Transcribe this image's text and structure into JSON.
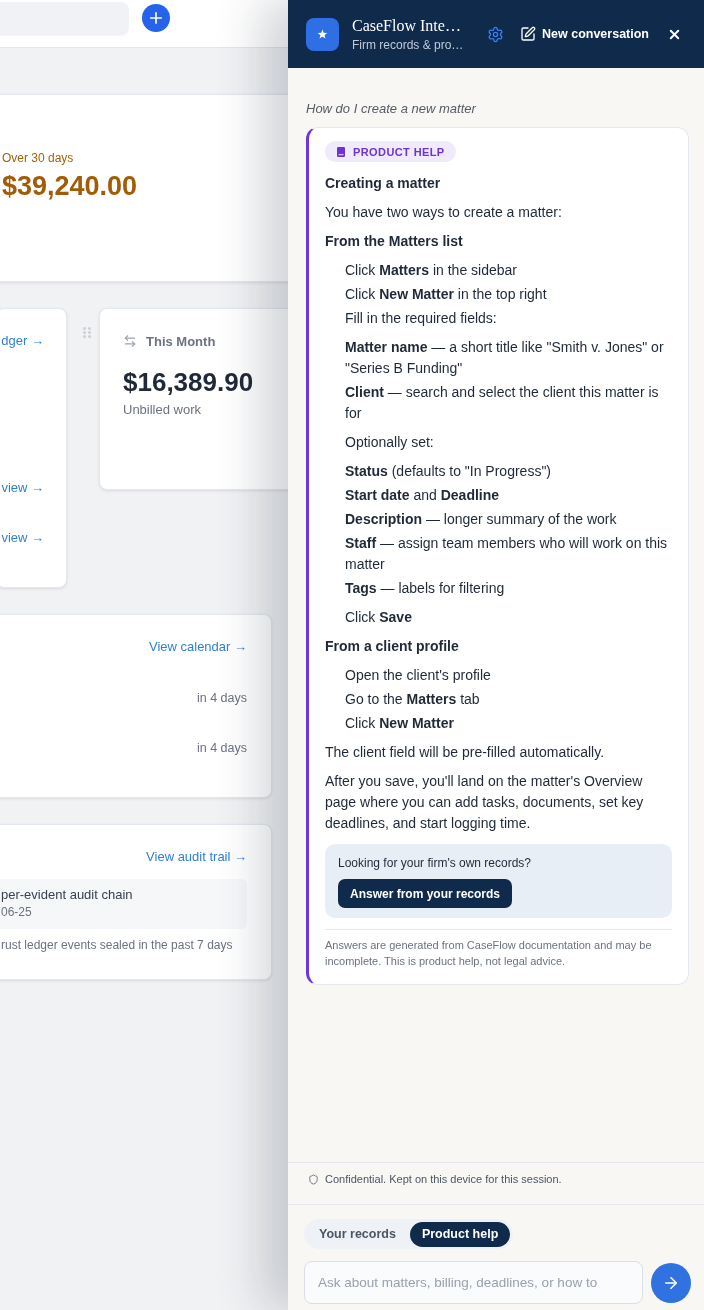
{
  "dashboard": {
    "aging_card": {
      "label": "Over 30 days",
      "amount": "$39,240.00"
    },
    "ledger_card": {
      "links": [
        "dger →",
        "view →",
        "view →"
      ]
    },
    "month_card": {
      "title": "This Month",
      "amount": "$16,389.90",
      "caption": "Unbilled work"
    },
    "deadlines_card": {
      "link": "View calendar →",
      "rows": [
        {
          "due": "in 4 days"
        },
        {
          "due": "in 4 days"
        }
      ]
    },
    "audit_card": {
      "link": "View audit trail →",
      "entry": {
        "title": "per-evident audit chain",
        "date": "06-25"
      },
      "note": "rust ledger events sealed in the past 7 days"
    }
  },
  "assistant": {
    "header": {
      "title": "CaseFlow Inte…",
      "subtitle": "Firm records & pro…",
      "new_conversation": "New conversation"
    },
    "question": "How do I create a new matter",
    "answer": {
      "badge": "PRODUCT HELP",
      "blocks": [
        {
          "kind": "heading",
          "text": "Creating a matter"
        },
        {
          "kind": "paragraph",
          "text": "You have two ways to create a matter:"
        },
        {
          "kind": "heading",
          "text": "From the Matters list"
        },
        {
          "kind": "list",
          "items": [
            "Click **Matters** in the sidebar",
            "Click **New Matter** in the top right",
            "Fill in the required fields:"
          ]
        },
        {
          "kind": "list",
          "items": [
            "**Matter name** — a short title like \"Smith v. Jones\" or \"Series B Funding\"",
            "**Client** — search and select the client this matter is for"
          ]
        },
        {
          "kind": "list",
          "items": [
            "Optionally set:"
          ]
        },
        {
          "kind": "list",
          "items": [
            "**Status** (defaults to \"In Progress\")",
            "**Start date** and **Deadline**",
            "**Description** — longer summary of the work",
            "**Staff** — assign team members who will work on this matter",
            "**Tags** — labels for filtering"
          ]
        },
        {
          "kind": "list",
          "items": [
            "Click **Save**"
          ]
        },
        {
          "kind": "heading",
          "text": "From a client profile"
        },
        {
          "kind": "list",
          "items": [
            "Open the client's profile",
            "Go to the **Matters** tab",
            "Click **New Matter**"
          ]
        },
        {
          "kind": "paragraph",
          "text": "The client field will be pre-filled automatically."
        },
        {
          "kind": "paragraph",
          "text": "After you save, you'll land on the matter's Overview page where you can add tasks, documents, set key deadlines, and start logging time."
        }
      ],
      "callout": {
        "text": "Looking for your firm's own records?",
        "button": "Answer from your records"
      },
      "disclaimer": "Answers are generated from CaseFlow documentation and may be incomplete. This is product help, not legal advice."
    },
    "privacy_note": "Confidential. Kept on this device for this session.",
    "modes": [
      {
        "label": "Your records",
        "selected": false
      },
      {
        "label": "Product help",
        "selected": true
      }
    ],
    "composer": {
      "placeholder": "Ask about matters, billing, deadlines, or how to"
    }
  }
}
